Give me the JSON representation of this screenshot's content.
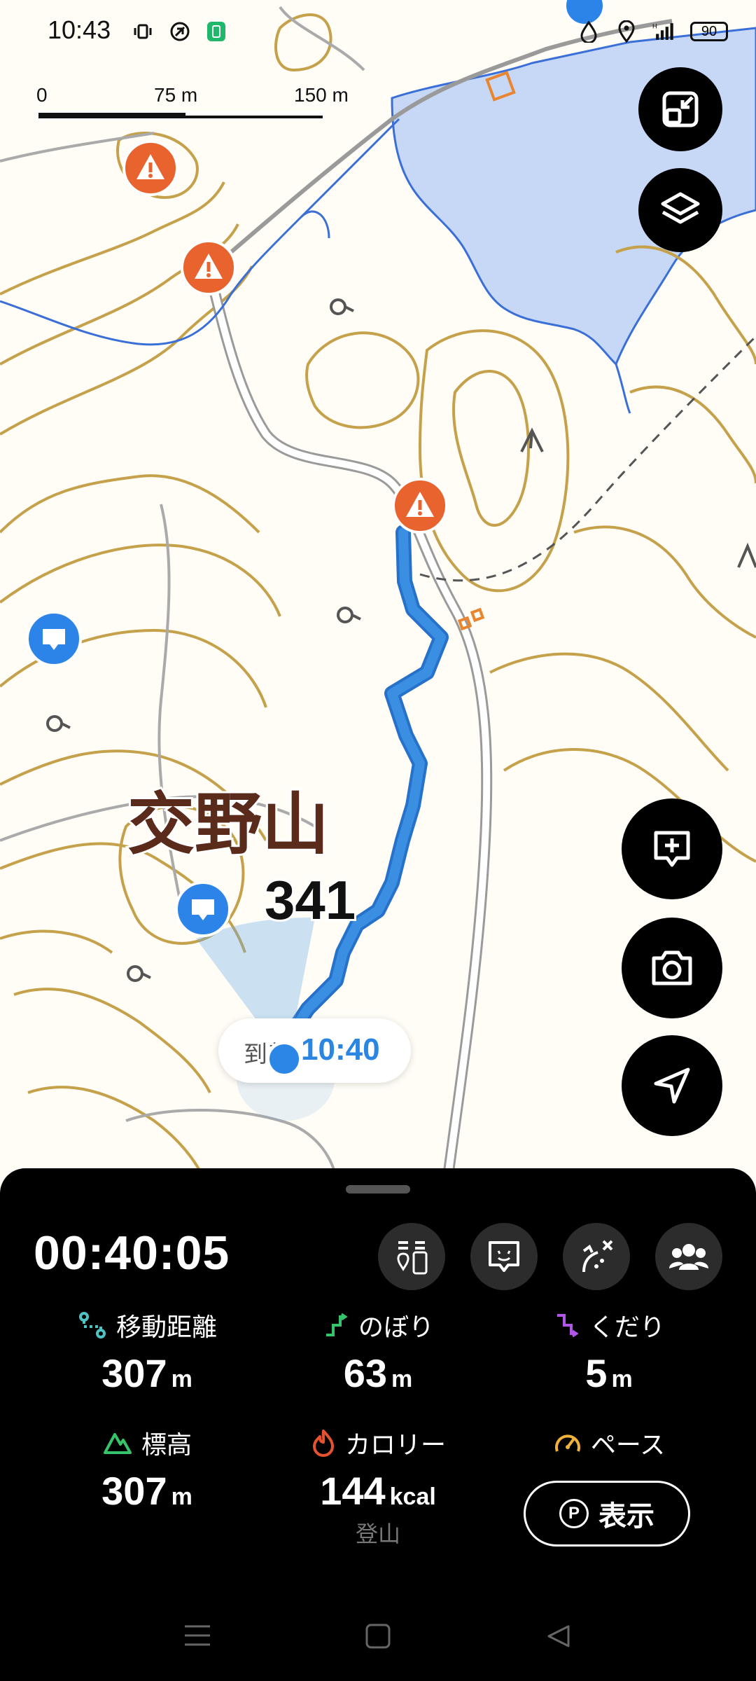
{
  "status_bar": {
    "time": "10:43",
    "battery": "90",
    "icons_left": [
      "vibrate-icon",
      "nfc-icon",
      "battery-saver-icon"
    ],
    "icons_right": [
      "water-drop-icon",
      "location-icon",
      "signal-icon",
      "battery-icon"
    ]
  },
  "map": {
    "scale": {
      "labels": [
        "0",
        "75 m",
        "150 m"
      ]
    },
    "peak_name": "交野山",
    "elevation": "341",
    "route_color": "#3b8fe3",
    "contour_color": "#c4a14a",
    "water_color": "#c6d8f6",
    "eta": {
      "prefix": "到着",
      "time": "10:40"
    }
  },
  "fab_buttons": [
    "minimize-map-button",
    "layers-button",
    "add-note-button",
    "camera-button",
    "navigate-button"
  ],
  "panel": {
    "timer": "00:40:05",
    "stats": [
      {
        "id": "distance",
        "label": "移動距離",
        "value": "307",
        "unit": "m",
        "icon": "route-icon",
        "color": "#4fc3c3"
      },
      {
        "id": "ascent",
        "label": "のぼり",
        "value": "63",
        "unit": "m",
        "icon": "ascent-icon",
        "color": "#36c46b"
      },
      {
        "id": "descent",
        "label": "くだり",
        "value": "5",
        "unit": "m",
        "icon": "descent-icon",
        "color": "#b057e8"
      },
      {
        "id": "altitude",
        "label": "標高",
        "value": "307",
        "unit": "m",
        "icon": "mountain-icon",
        "color": "#36c46b"
      },
      {
        "id": "calories",
        "label": "カロリー",
        "value": "144",
        "unit": "kcal",
        "sub": "登山",
        "icon": "flame-icon",
        "color": "#e4522f"
      },
      {
        "id": "pace",
        "label": "ペース",
        "icon": "speedometer-icon",
        "color": "#f0b23a"
      }
    ],
    "show_button": {
      "badge": "P",
      "label": "表示"
    }
  }
}
